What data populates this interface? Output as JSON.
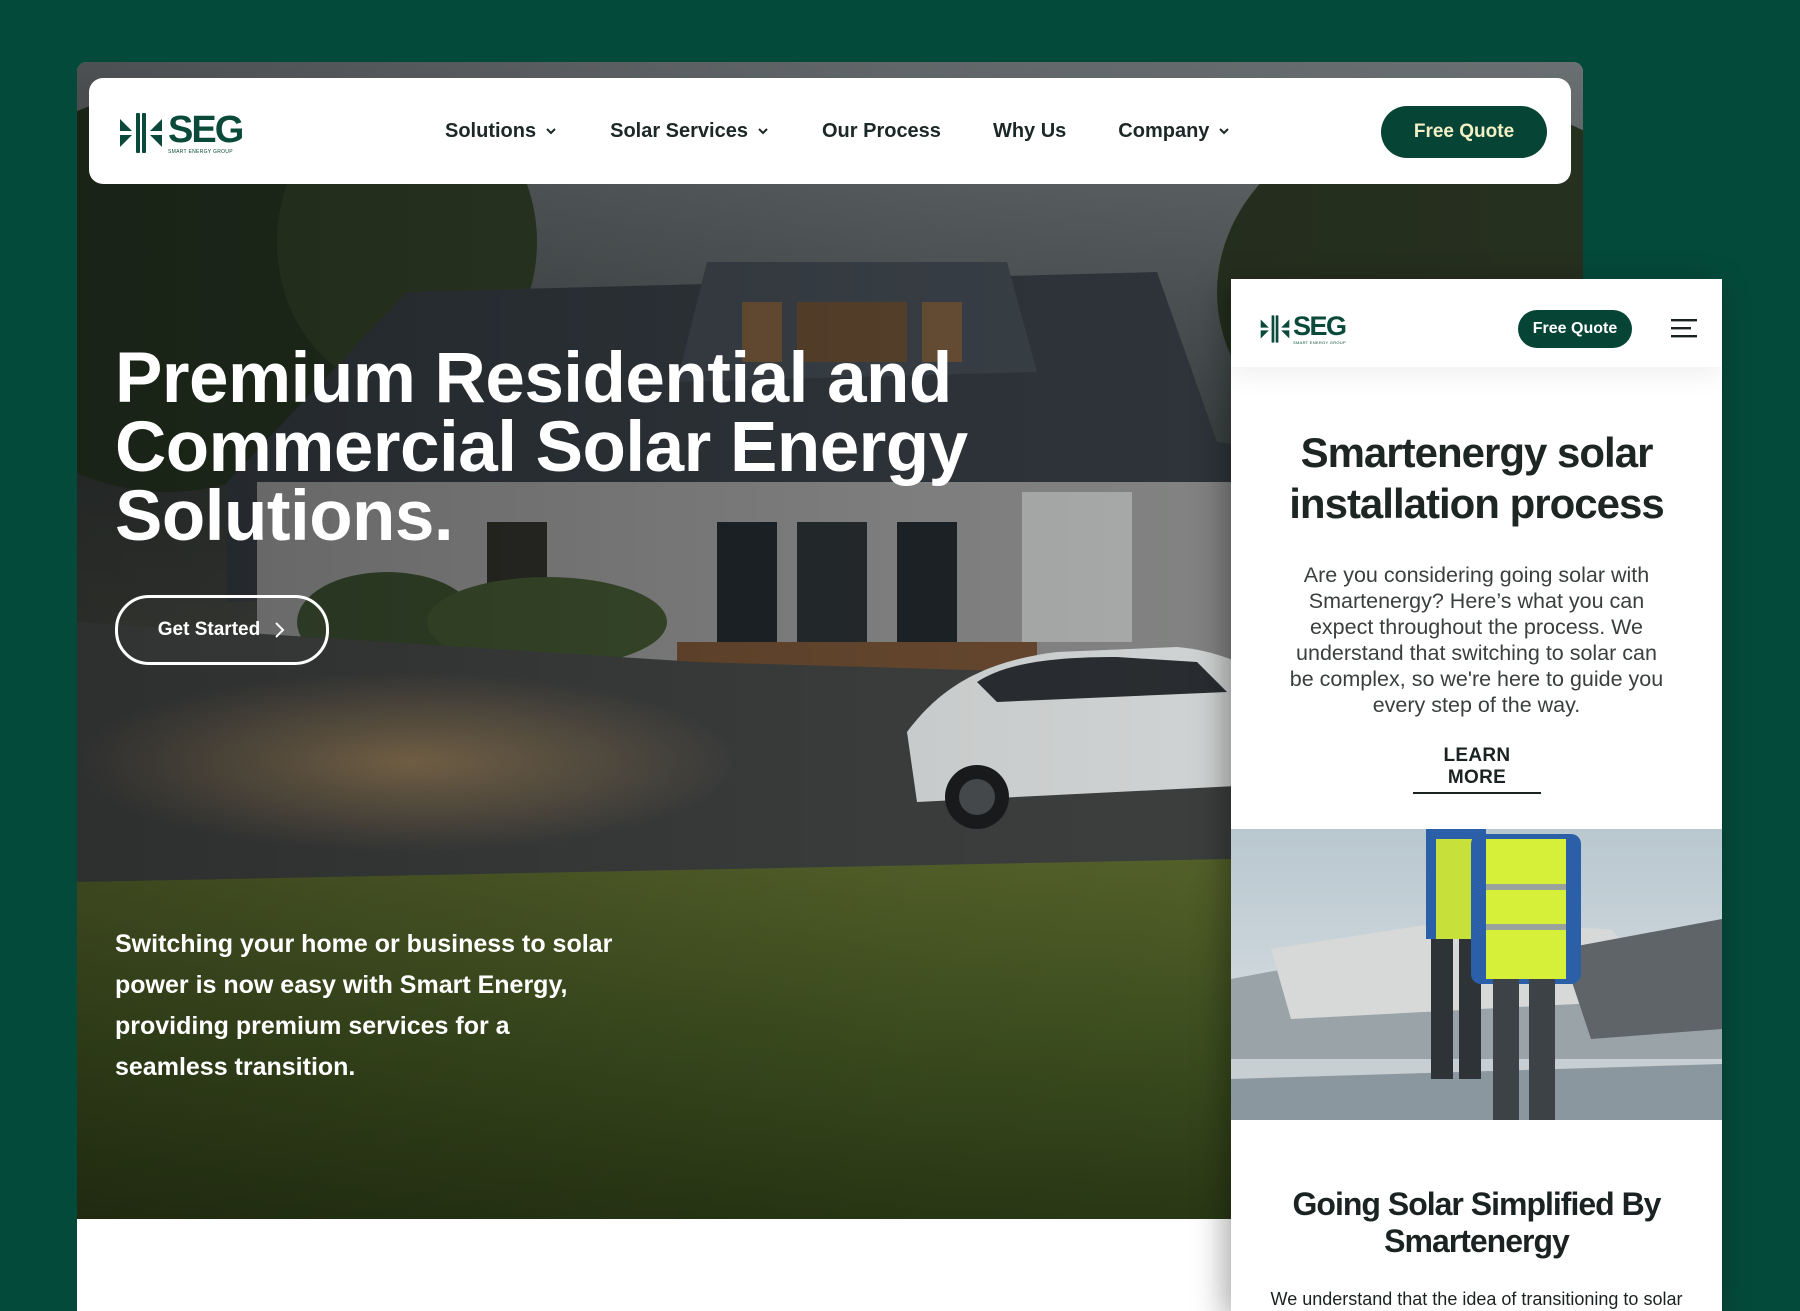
{
  "brand": {
    "name": "SEG",
    "tagline": "SMART ENERGY GROUP"
  },
  "colors": {
    "background": "#044a3b",
    "brand_green": "#064435",
    "quote_text": "#f3f0c6",
    "white": "#ffffff"
  },
  "desktop": {
    "nav": {
      "items": [
        {
          "label": "Solutions",
          "has_dropdown": true
        },
        {
          "label": "Solar Services",
          "has_dropdown": true
        },
        {
          "label": "Our Process",
          "has_dropdown": false
        },
        {
          "label": "Why Us",
          "has_dropdown": false
        },
        {
          "label": "Company",
          "has_dropdown": true
        }
      ],
      "cta_label": "Free Quote"
    },
    "hero": {
      "title_lines": [
        "Premium Residential and",
        "Commercial Solar Energy",
        "Solutions."
      ],
      "cta_label": "Get Started",
      "description_lines": [
        "Switching your home or business to solar",
        "power is now easy with Smart Energy,",
        "providing premium services for a",
        "seamless transition."
      ]
    }
  },
  "mobile": {
    "cta_label": "Free Quote",
    "menu_icon": "hamburger-icon",
    "section1": {
      "title_lines": [
        "Smartenergy solar",
        "installation process"
      ],
      "text_lines": [
        "Are you considering going solar with",
        "Smartenergy? Here’s what you can",
        "expect throughout the process. We",
        "understand that switching to solar can",
        "be complex, so we're here to guide you",
        "every step of the way."
      ],
      "link_label": "LEARN MORE"
    },
    "section2": {
      "title_lines": [
        "Going Solar Simplified By",
        "Smartenergy"
      ],
      "text_lines": [
        "We understand that the idea of transitioning to solar"
      ]
    }
  }
}
